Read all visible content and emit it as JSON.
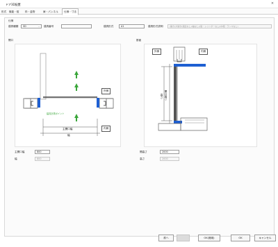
{
  "window": {
    "title": "ドア3D配置",
    "close_glyph": "×"
  },
  "tabs": [
    {
      "label": "形式"
    },
    {
      "label": "機能・錠"
    },
    {
      "label": "枠・金物"
    },
    {
      "label": "扉・パンネル"
    },
    {
      "label": "仕様・寸法"
    }
  ],
  "spec": {
    "section_title": "仕様",
    "type_label": "建具種類",
    "type_value": "SD",
    "number_label": "建具番号",
    "number_value": "",
    "form_label": "建具形式",
    "form_value": "A1",
    "desc_label": "建具形式説明",
    "desc_placeholder": "(開き)片開き(親扉なし)(袖なし)(鍵・シリンダーなし)(中桟・ランマなし)"
  },
  "plan": {
    "section_title": "開口",
    "outside": "外側",
    "inside": "内側",
    "nominal_width": "主開口幅",
    "width": "幅",
    "point": "建具計測ポイント",
    "fields": [
      {
        "label": "主開口幅",
        "value": "800",
        "disabled": false
      },
      {
        "label": "幅",
        "value": "800",
        "disabled": true
      }
    ]
  },
  "section": {
    "section_title": "断面",
    "outside": "外側",
    "inside": "内側",
    "height": "高さ",
    "opening_height": "開口高さ",
    "fields": [
      {
        "label": "開高さ",
        "value": "2000",
        "disabled": false
      },
      {
        "label": "高さ",
        "value": "2000",
        "disabled": true
      }
    ]
  },
  "footer": {
    "prev": "前へ",
    "next": "",
    "save": "OK(適用)",
    "ok": "OK",
    "cancel": "キャンセル"
  },
  "colors": {
    "frame": "#1e5fd2",
    "arrow": "#3aa63a",
    "wall": "#666"
  }
}
